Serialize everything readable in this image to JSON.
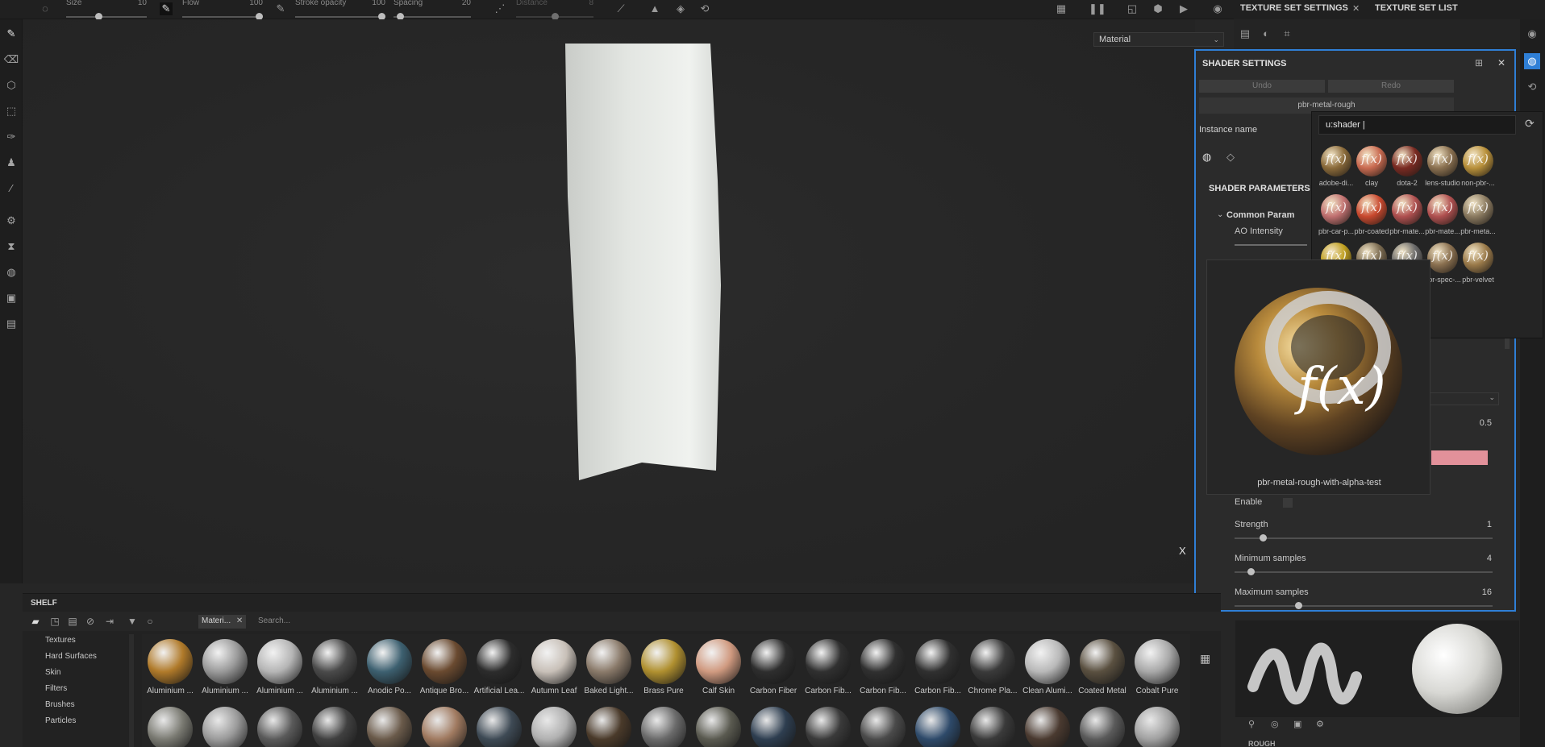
{
  "toolbar": {
    "size": {
      "label": "Size",
      "value": "10",
      "level": 0.4
    },
    "flow": {
      "label": "Flow",
      "value": "100",
      "level": 1.0
    },
    "stroke_opacity": {
      "label": "Stroke opacity",
      "value": "100",
      "level": 1.0
    },
    "spacing": {
      "label": "Spacing",
      "value": "20",
      "level": 0.05
    },
    "distance": {
      "label": "Distance",
      "value": "8",
      "level": 0.5
    }
  },
  "viewport": {
    "material_dropdown": "Material",
    "axis_label": "X"
  },
  "right_header": {
    "tab_texture_set_settings": "TEXTURE SET SETTINGS",
    "tab_texture_set_list": "TEXTURE SET LIST",
    "close_glyph": "✕"
  },
  "shader_panel": {
    "title": "SHADER SETTINGS",
    "undo": "Undo",
    "redo": "Redo",
    "shader_name": "pbr-metal-rough",
    "instance_name_label": "Instance name",
    "parameters_title": "SHADER PARAMETERS",
    "common_params": "Common Param",
    "ao_intensity": "AO Intensity",
    "value_0_5": "0.5",
    "enable": "Enable",
    "strength": {
      "label": "Strength",
      "value": "1",
      "level": 0.1
    },
    "min_samples": {
      "label": "Minimum samples",
      "value": "4",
      "level": 0.05
    },
    "max_samples": {
      "label": "Maximum samples",
      "value": "16",
      "level": 0.24
    }
  },
  "picker": {
    "search_value": "u:shader |",
    "shaders": [
      {
        "name": "adobe-di...",
        "color": "#8a6a3a"
      },
      {
        "name": "clay",
        "color": "#c96a50"
      },
      {
        "name": "dota-2",
        "color": "#7a2a22"
      },
      {
        "name": "lens-studio",
        "color": "#8a7050"
      },
      {
        "name": "non-pbr-...",
        "color": "#b8903a"
      },
      {
        "name": "pbr-car-p...",
        "color": "#c07070"
      },
      {
        "name": "pbr-coated",
        "color": "#c8482e"
      },
      {
        "name": "pbr-mate...",
        "color": "#b05050"
      },
      {
        "name": "pbr-mate...",
        "color": "#b05050"
      },
      {
        "name": "pbr-meta...",
        "color": "#8a7a60"
      },
      {
        "name": "",
        "color": "#c0a020"
      },
      {
        "name": "",
        "color": "#7a6a50"
      },
      {
        "name": "",
        "color": "#6a6a6a"
      },
      {
        "name": "pbr-spec-...",
        "color": "#8a7050"
      },
      {
        "name": "pbr-velvet",
        "color": "#9a7a4a"
      }
    ]
  },
  "tooltip": {
    "caption": "pbr-metal-rough-with-alpha-test",
    "symbol": "f(x)"
  },
  "shelf": {
    "title": "SHELF",
    "tag": "Materi...",
    "tag_close": "✕",
    "search_placeholder": "Search...",
    "categories": [
      "Textures",
      "Hard Surfaces",
      "Skin",
      "Filters",
      "Brushes",
      "Particles"
    ],
    "materials": [
      {
        "name": "Aluminium ...",
        "color": "#b07a2a"
      },
      {
        "name": "Aluminium ...",
        "color": "#9a9a9a"
      },
      {
        "name": "Aluminium ...",
        "color": "#b5b5b5"
      },
      {
        "name": "Aluminium ...",
        "color": "#4a4a4a"
      },
      {
        "name": "Anodic Po...",
        "color": "#3d6070"
      },
      {
        "name": "Antique Bro...",
        "color": "#6a4a30"
      },
      {
        "name": "Artificial Lea...",
        "color": "#2c2c2c"
      },
      {
        "name": "Autumn Leaf",
        "color": "#c8c0b8"
      },
      {
        "name": "Baked Light...",
        "color": "#8a7a6a"
      },
      {
        "name": "Brass Pure",
        "color": "#b09030"
      },
      {
        "name": "Calf Skin",
        "color": "#d09a80"
      },
      {
        "name": "Carbon Fiber",
        "color": "#2e2e2e"
      },
      {
        "name": "Carbon Fib...",
        "color": "#303030"
      },
      {
        "name": "Carbon Fib...",
        "color": "#303030"
      },
      {
        "name": "Carbon Fib...",
        "color": "#303030"
      },
      {
        "name": "Chrome Pla...",
        "color": "#3a3a3a"
      },
      {
        "name": "Clean Alumi...",
        "color": "#b8b8b8"
      },
      {
        "name": "Coated Metal",
        "color": "#5a5040"
      },
      {
        "name": "Cobalt Pure",
        "color": "#a8a8a8"
      }
    ],
    "row2_colors": [
      "#7a7a72",
      "#9a9a9a",
      "#5a5a5a",
      "#404040",
      "#6a5a4a",
      "#a07a60",
      "#3e4a55",
      "#b0b0b0",
      "#4a3a2a",
      "#6a6a6a",
      "#5a5a50",
      "#2e3e50",
      "#3a3a3a",
      "#4a4a4a",
      "#2e4a6a",
      "#3a3a3a",
      "#4a3a30",
      "#5a5a5a",
      "#a0a0a0"
    ]
  },
  "preview": {
    "label": "ROUGH"
  }
}
